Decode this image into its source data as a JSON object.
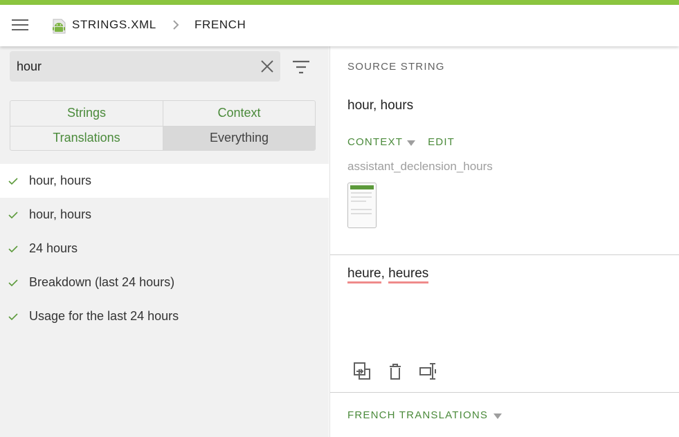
{
  "header": {
    "file_name": "STRINGS.XML",
    "language": "FRENCH",
    "icons": {
      "menu": "menu-icon",
      "file": "android-icon",
      "separator": "chevron-right-icon"
    },
    "accent_color": "#8bc53f"
  },
  "search": {
    "value": "hour",
    "icons": {
      "clear": "close-icon",
      "filter": "filter-icon"
    }
  },
  "filter_tabs": [
    {
      "label": "Strings",
      "active": false
    },
    {
      "label": "Context",
      "active": false
    },
    {
      "label": "Translations",
      "active": false
    },
    {
      "label": "Everything",
      "active": true
    }
  ],
  "results": [
    {
      "label": "hour, hours",
      "translated": true,
      "selected": true
    },
    {
      "label": "hour, hours",
      "translated": true,
      "selected": false
    },
    {
      "label": "24 hours",
      "translated": true,
      "selected": false
    },
    {
      "label": "Breakdown (last 24 hours)",
      "translated": true,
      "selected": false
    },
    {
      "label": "Usage for the last 24 hours",
      "translated": true,
      "selected": false
    }
  ],
  "detail": {
    "source_title": "SOURCE STRING",
    "source_text": "hour, hours",
    "context_label": "CONTEXT",
    "edit_label": "EDIT",
    "context_key": "assistant_declension_hours",
    "translation_words": [
      "heure",
      ", ",
      "heures"
    ],
    "tools": [
      "copy-source-icon",
      "delete-icon",
      "text-cursor-icon"
    ],
    "french_translations_label": "FRENCH TRANSLATIONS"
  },
  "colors": {
    "green_text": "#4a8a3a",
    "check": "#5c9a3b",
    "spell_underline": "#ef8b8b"
  }
}
